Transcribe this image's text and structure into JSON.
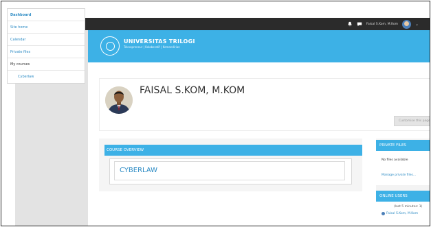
{
  "navbar": {
    "close_glyph": "✕",
    "user_name": "Faisal S.Kom, M.Kom",
    "icons": [
      "notification-bell-icon",
      "messages-icon",
      "avatar",
      "chevron-down-icon"
    ],
    "caret_glyph": "⌄"
  },
  "sidebar": {
    "items": [
      {
        "label": "Dashboard",
        "style": "bold"
      },
      {
        "label": "Site home",
        "style": "link"
      },
      {
        "label": "Calendar",
        "style": "link"
      },
      {
        "label": "Private files",
        "style": "link"
      },
      {
        "label": "My courses",
        "style": "plain"
      },
      {
        "label": "Cyberlaw",
        "style": "sub"
      }
    ]
  },
  "header": {
    "logo_title": "UNIVERSITAS TRILOGI",
    "logo_subtitle": "Teknopreneur | Kolaboratif | Kemandirian"
  },
  "profile": {
    "name": "FAISAL S.KOM, M.KOM",
    "customise_label": "Customise this page"
  },
  "course_overview": {
    "header": "COURSE OVERVIEW",
    "courses": [
      "CYBERLAW"
    ]
  },
  "private_files": {
    "header": "PRIVATE FILES",
    "empty_text": "No files available",
    "manage_link": "Manage private files..."
  },
  "online_users": {
    "header": "ONLINE USERS",
    "period": "(last 5 minutes: 1)",
    "users": [
      "Faisal S.Kom, M.Kom"
    ]
  },
  "colors": {
    "accent": "#3db1e6",
    "link": "#2c8bc4",
    "navbar": "#2b2b2b",
    "sidebar_bg": "#e3e3e3"
  }
}
